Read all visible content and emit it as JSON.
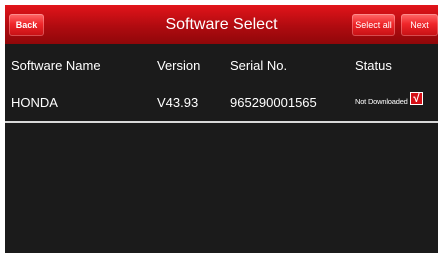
{
  "header": {
    "title": "Software Select",
    "back_label": "Back",
    "select_all_label": "Select all",
    "next_label": "Next"
  },
  "table": {
    "columns": [
      "Software Name",
      "Version",
      "Serial No.",
      "Status"
    ],
    "rows": [
      {
        "name": "HONDA",
        "version": "V43.93",
        "serial": "965290001565",
        "status": "Not Downloaded",
        "checked": true,
        "check_mark": "√"
      }
    ]
  },
  "colors": {
    "accent": "#d40f16",
    "background": "#1b1b1b",
    "text": "#ffffff"
  }
}
